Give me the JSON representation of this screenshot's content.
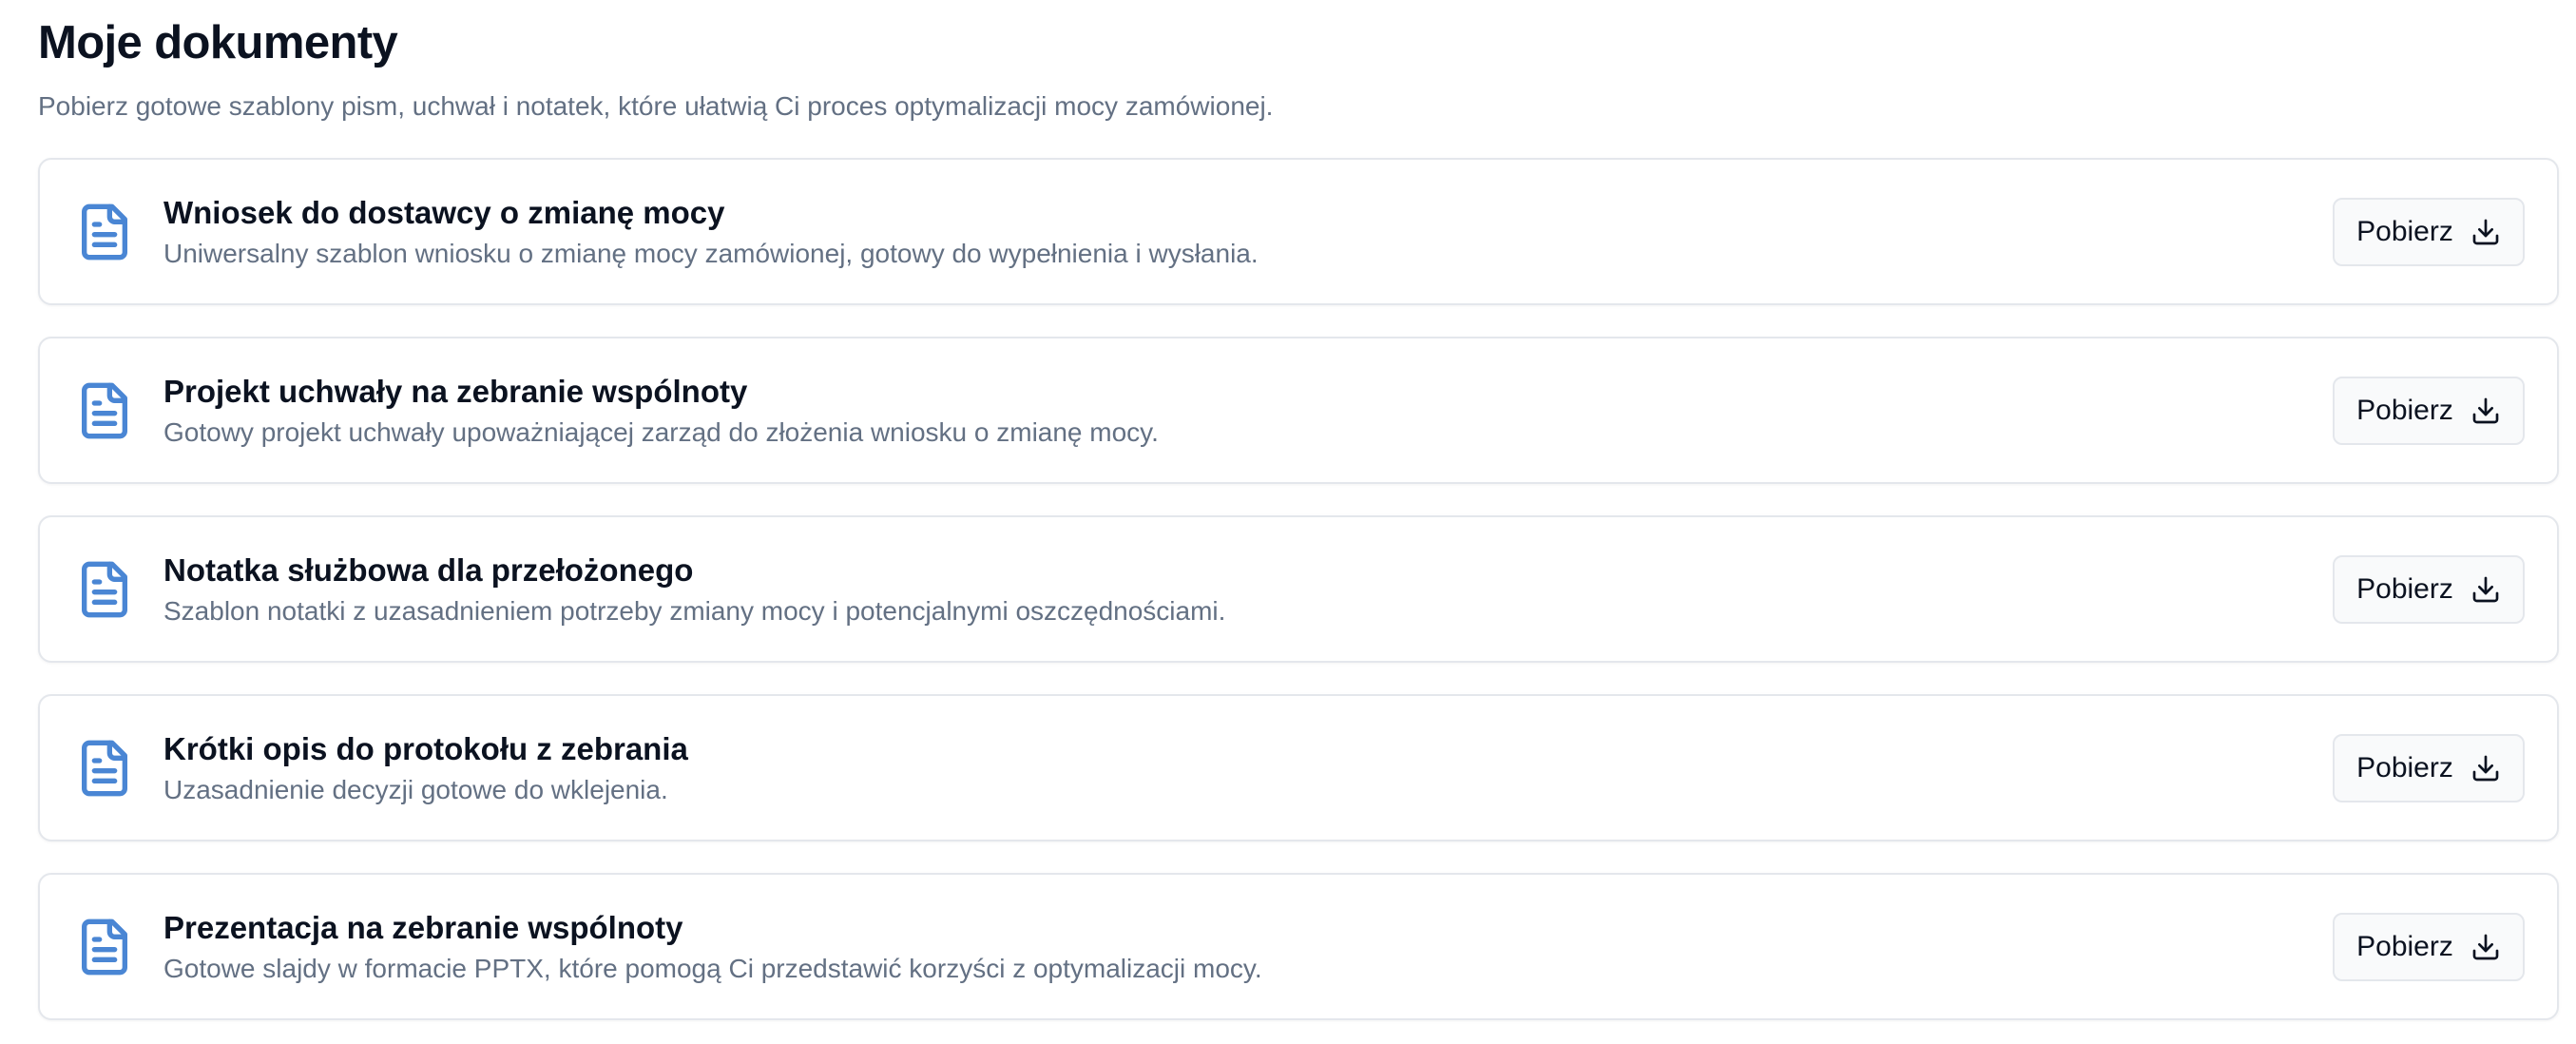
{
  "header": {
    "title": "Moje dokumenty",
    "subtitle": "Pobierz gotowe szablony pism, uchwał i notatek, które ułatwią Ci proces optymalizacji mocy zamówionej."
  },
  "colors": {
    "accent": "#4a86d4",
    "title_text": "#0b1220",
    "muted_text": "#637083",
    "border": "#e4e7ec"
  },
  "documents": [
    {
      "icon": "file-text-icon",
      "title": "Wniosek do dostawcy o zmianę mocy",
      "description": "Uniwersalny szablon wniosku o zmianę mocy zamówionej, gotowy do wypełnienia i wysłania.",
      "button_label": "Pobierz",
      "button_icon": "download-icon"
    },
    {
      "icon": "file-text-icon",
      "title": "Projekt uchwały na zebranie wspólnoty",
      "description": "Gotowy projekt uchwały upoważniającej zarząd do złożenia wniosku o zmianę mocy.",
      "button_label": "Pobierz",
      "button_icon": "download-icon"
    },
    {
      "icon": "file-text-icon",
      "title": "Notatka służbowa dla przełożonego",
      "description": "Szablon notatki z uzasadnieniem potrzeby zmiany mocy i potencjalnymi oszczędnościami.",
      "button_label": "Pobierz",
      "button_icon": "download-icon"
    },
    {
      "icon": "file-text-icon",
      "title": "Krótki opis do protokołu z zebrania",
      "description": "Uzasadnienie decyzji gotowe do wklejenia.",
      "button_label": "Pobierz",
      "button_icon": "download-icon"
    },
    {
      "icon": "file-text-icon",
      "title": "Prezentacja na zebranie wspólnoty",
      "description": "Gotowe slajdy w formacie PPTX, które pomogą Ci przedstawić korzyści z optymalizacji mocy.",
      "button_label": "Pobierz",
      "button_icon": "download-icon"
    }
  ]
}
